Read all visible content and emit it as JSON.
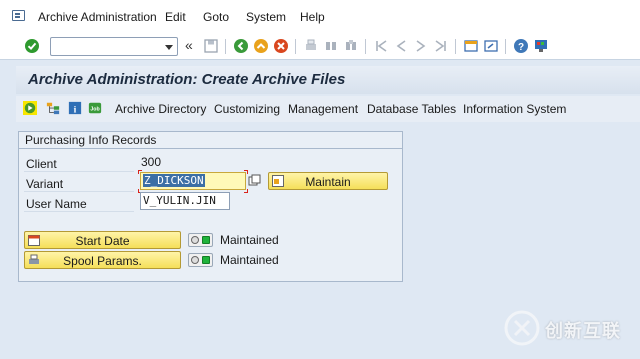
{
  "menubar": {
    "items": [
      "Archive Administration",
      "Edit",
      "Goto",
      "System",
      "Help"
    ]
  },
  "toolbar": {
    "command_field_value": "",
    "back_symbol": "«"
  },
  "header": {
    "title": "Archive Administration: Create Archive Files"
  },
  "app_toolbar": {
    "buttons": [
      "Archive Directory",
      "Customizing",
      "Management",
      "Database Tables",
      "Information System"
    ]
  },
  "group": {
    "title": "Purchasing Info Records",
    "client_label": "Client",
    "client_value": "300",
    "variant_label": "Variant",
    "variant_value": "Z_DICKSON",
    "maintain_label": "Maintain",
    "username_label": "User Name",
    "username_value": "V_YULIN.JIN",
    "start_date_label": "Start Date",
    "spool_label": "Spool Params.",
    "start_date_status": "Maintained",
    "spool_status": "Maintained"
  },
  "watermark": {
    "text": "创新互联"
  },
  "colors": {
    "led_green": "#1fb33a",
    "button_yellow": "#f5df5a",
    "title_bg": "#dfe8f3"
  }
}
